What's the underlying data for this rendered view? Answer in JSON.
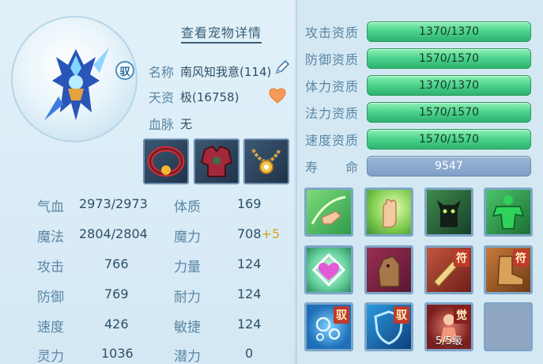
{
  "header": {
    "detail_link": "查看宠物详情"
  },
  "pet": {
    "ride_badge": "驭",
    "name_label": "名称",
    "name_value": "南风知我意(114)",
    "talent_label": "天资",
    "talent_value": "极(16758)",
    "bloodline_label": "血脉",
    "bloodline_value": "无"
  },
  "stats": {
    "hp_label": "气血",
    "hp_value": "2973/2973",
    "mp_label": "魔法",
    "mp_value": "2804/2804",
    "atk_label": "攻击",
    "atk_value": "766",
    "def_label": "防御",
    "def_value": "769",
    "spd_label": "速度",
    "spd_value": "426",
    "sp_label": "灵力",
    "sp_value": "1036",
    "con_label": "体质",
    "con_value": "169",
    "mag_label": "魔力",
    "mag_value": "708",
    "mag_bonus": "+5",
    "str_label": "力量",
    "str_value": "124",
    "end_label": "耐力",
    "end_value": "124",
    "agi_label": "敏捷",
    "agi_value": "124",
    "pot_label": "潜力",
    "pot_value": "0"
  },
  "quality": [
    {
      "label": "攻击资质",
      "value": "1370/1370"
    },
    {
      "label": "防御资质",
      "value": "1570/1570"
    },
    {
      "label": "体力资质",
      "value": "1370/1370"
    },
    {
      "label": "法力资质",
      "value": "1570/1570"
    },
    {
      "label": "速度资质",
      "value": "1570/1570"
    }
  ],
  "life": {
    "label": "寿　　命",
    "value": "9547"
  },
  "skills": {
    "tag_fu": "符",
    "tag_yu": "驭",
    "tag_jue": "觉",
    "awaken_level": "5/5级"
  },
  "colors": {
    "quality_bar": "#49d18a",
    "life_bar": "#7f9fc6",
    "accent": "#3a5e77"
  }
}
